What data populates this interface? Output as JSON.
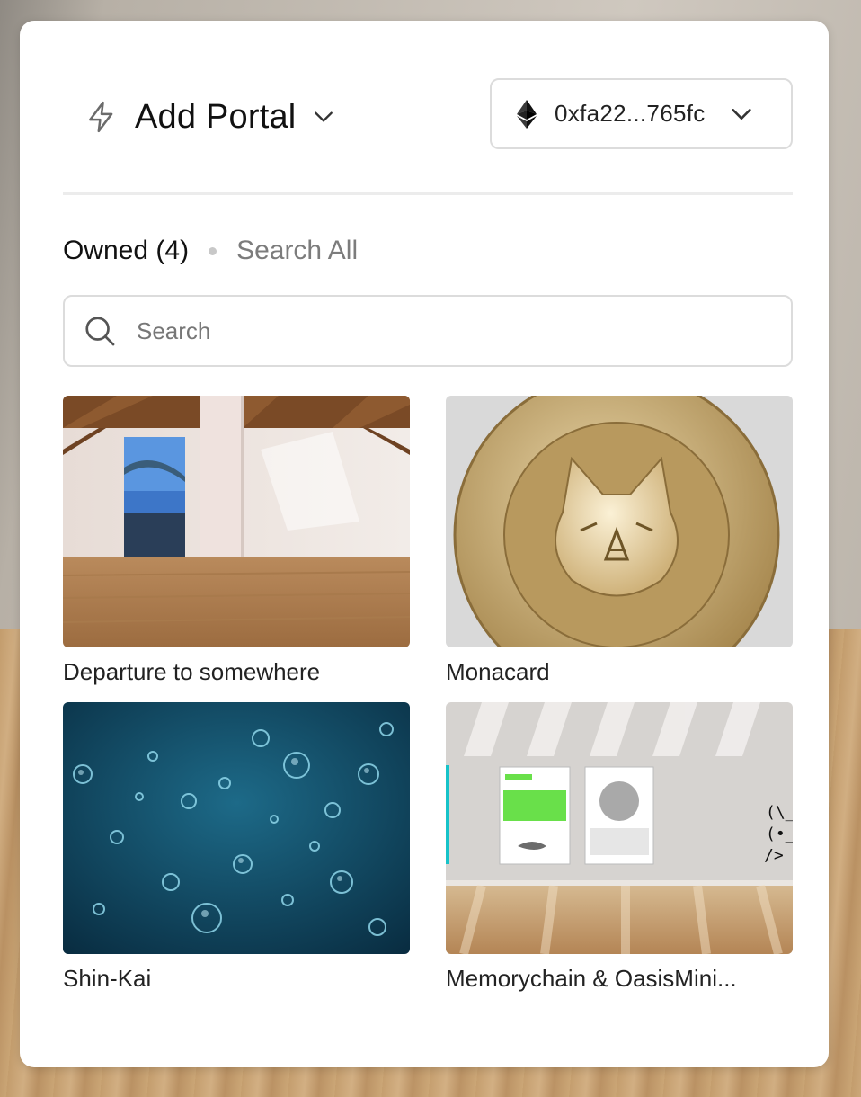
{
  "header": {
    "title": "Add Portal",
    "title_icon": "bolt-icon",
    "wallet_address": "0xfa22...765fc",
    "wallet_icon": "ethereum-icon"
  },
  "tabs": [
    {
      "label": "Owned (4)",
      "active": true
    },
    {
      "label": "Search All",
      "active": false
    }
  ],
  "search": {
    "placeholder": "Search",
    "value": ""
  },
  "portals": [
    {
      "name": "Departure to somewhere"
    },
    {
      "name": "Monacard"
    },
    {
      "name": "Shin-Kai"
    },
    {
      "name": "Memorychain & OasisMini..."
    }
  ],
  "colors": {
    "text": "#111111",
    "muted": "#7c7c7c",
    "border": "#dcdcdc",
    "panel": "#ffffff"
  }
}
